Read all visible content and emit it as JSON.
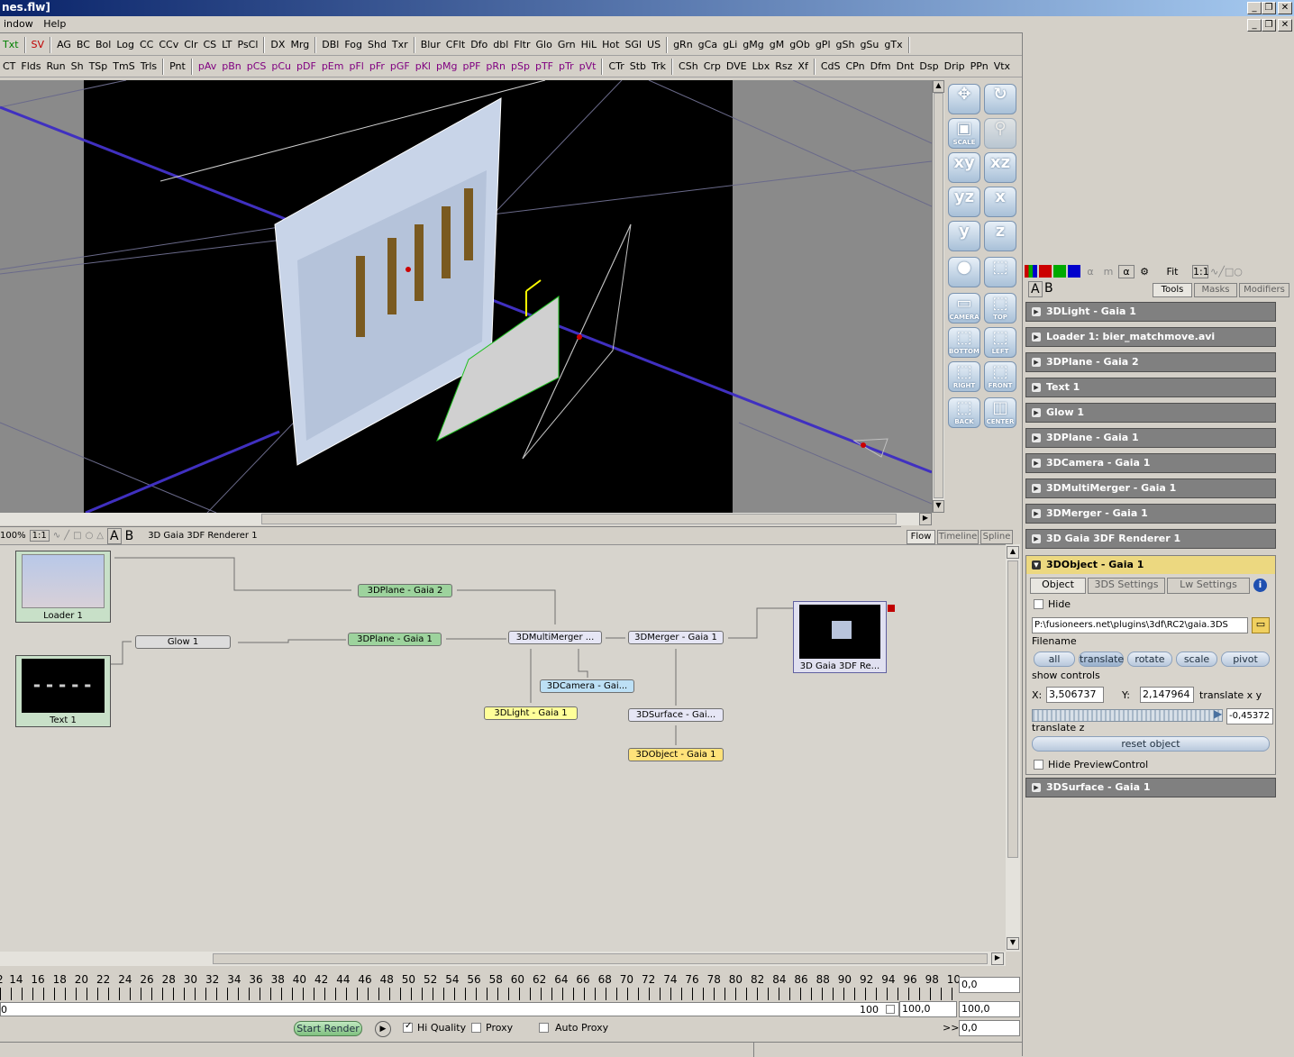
{
  "window": {
    "title": "nes.flw]"
  },
  "menu": {
    "items": [
      "indow",
      "Help"
    ]
  },
  "toolbar1": {
    "items": [
      {
        "t": "Txt",
        "c": "green"
      },
      {
        "t": "|"
      },
      {
        "t": "SV",
        "c": "red"
      },
      {
        "t": "|"
      },
      {
        "t": "AG"
      },
      {
        "t": "BC"
      },
      {
        "t": "Bol"
      },
      {
        "t": "Log"
      },
      {
        "t": "CC"
      },
      {
        "t": "CCv"
      },
      {
        "t": "Clr"
      },
      {
        "t": "CS"
      },
      {
        "t": "LT"
      },
      {
        "t": "PsCl"
      },
      {
        "t": "|"
      },
      {
        "t": "DX"
      },
      {
        "t": "Mrg"
      },
      {
        "t": "|"
      },
      {
        "t": "DBl"
      },
      {
        "t": "Fog"
      },
      {
        "t": "Shd"
      },
      {
        "t": "Txr"
      },
      {
        "t": "|"
      },
      {
        "t": "Blur"
      },
      {
        "t": "CFlt"
      },
      {
        "t": "Dfo"
      },
      {
        "t": "dbl"
      },
      {
        "t": "Fltr"
      },
      {
        "t": "Glo"
      },
      {
        "t": "Grn"
      },
      {
        "t": "HiL"
      },
      {
        "t": "Hot"
      },
      {
        "t": "SGl"
      },
      {
        "t": "US"
      },
      {
        "t": "|"
      },
      {
        "t": "gRn"
      },
      {
        "t": "gCa"
      },
      {
        "t": "gLi"
      },
      {
        "t": "gMg"
      },
      {
        "t": "gM"
      },
      {
        "t": "gOb"
      },
      {
        "t": "gPl"
      },
      {
        "t": "gSh"
      },
      {
        "t": "gSu"
      },
      {
        "t": "gTx"
      },
      {
        "t": "|"
      }
    ]
  },
  "toolbar2": {
    "items": [
      {
        "t": "CT"
      },
      {
        "t": "Flds"
      },
      {
        "t": "Run"
      },
      {
        "t": "Sh"
      },
      {
        "t": "TSp"
      },
      {
        "t": "TmS"
      },
      {
        "t": "Trls"
      },
      {
        "t": "|"
      },
      {
        "t": "Pnt"
      },
      {
        "t": "|"
      },
      {
        "t": "pAv",
        "c": "purple"
      },
      {
        "t": "pBn",
        "c": "purple"
      },
      {
        "t": "pCS",
        "c": "purple"
      },
      {
        "t": "pCu",
        "c": "purple"
      },
      {
        "t": "pDF",
        "c": "purple"
      },
      {
        "t": "pEm",
        "c": "purple"
      },
      {
        "t": "pFl",
        "c": "purple"
      },
      {
        "t": "pFr",
        "c": "purple"
      },
      {
        "t": "pGF",
        "c": "purple"
      },
      {
        "t": "pKl",
        "c": "purple"
      },
      {
        "t": "pMg",
        "c": "purple"
      },
      {
        "t": "pPF",
        "c": "purple"
      },
      {
        "t": "pRn",
        "c": "purple"
      },
      {
        "t": "pSp",
        "c": "purple"
      },
      {
        "t": "pTF",
        "c": "purple"
      },
      {
        "t": "pTr",
        "c": "purple"
      },
      {
        "t": "pVt",
        "c": "purple"
      },
      {
        "t": "|"
      },
      {
        "t": "CTr"
      },
      {
        "t": "Stb"
      },
      {
        "t": "Trk"
      },
      {
        "t": "|"
      },
      {
        "t": "CSh"
      },
      {
        "t": "Crp"
      },
      {
        "t": "DVE"
      },
      {
        "t": "Lbx"
      },
      {
        "t": "Rsz"
      },
      {
        "t": "Xf"
      },
      {
        "t": "|"
      },
      {
        "t": "CdS"
      },
      {
        "t": "CPn"
      },
      {
        "t": "Dfm"
      },
      {
        "t": "Dnt"
      },
      {
        "t": "Dsp"
      },
      {
        "t": "Drip"
      },
      {
        "t": "PPn"
      },
      {
        "t": "Vtx"
      }
    ]
  },
  "tools3d": {
    "labels": [
      "SCALE",
      "CAMERA",
      "TOP",
      "BOTTOM",
      "LEFT",
      "RIGHT",
      "FRONT",
      "BACK",
      "CENTER"
    ],
    "axes": [
      "xy",
      "xz",
      "yz",
      "x",
      "y",
      "z"
    ]
  },
  "viewer": {
    "zoom": "100%",
    "ratio": "1:1",
    "a": "A",
    "b": "B",
    "title": "3D Gaia 3DF Renderer 1",
    "tabs": [
      "Flow",
      "Timeline",
      "Spline"
    ]
  },
  "flow": {
    "nodes": {
      "loader": "Loader 1",
      "text": "Text 1",
      "plane2": "3DPlane - Gaia 2",
      "glow": "Glow 1",
      "plane1": "3DPlane - Gaia 1",
      "multimerger": "3DMultiMerger ...",
      "merger": "3DMerger - Gaia 1",
      "camera": "3DCamera - Gai...",
      "light": "3DLight - Gaia 1",
      "surface": "3DSurface - Gai...",
      "object": "3DObject - Gaia 1",
      "renderer": "3D Gaia 3DF Re..."
    }
  },
  "timeline": {
    "ticks": [
      "2",
      "14",
      "16",
      "18",
      "20",
      "22",
      "24",
      "26",
      "28",
      "30",
      "32",
      "34",
      "36",
      "38",
      "40",
      "42",
      "44",
      "46",
      "48",
      "50",
      "52",
      "54",
      "56",
      "58",
      "60",
      "62",
      "64",
      "66",
      "68",
      "70",
      "72",
      "74",
      "76",
      "78",
      "80",
      "82",
      "84",
      "86",
      "88",
      "90",
      "92",
      "94",
      "96",
      "98",
      "10"
    ],
    "field_top": "0,0",
    "start": "0",
    "end_label": "100",
    "end_value": "100,0",
    "field_mid": "100,0",
    "field_bottom": "0,0",
    "render_label": "Start Render",
    "hiquality": "Hi Quality",
    "proxy": "Proxy",
    "autoproxy": "Auto Proxy",
    "ff": ">>"
  },
  "panel": {
    "fit": "Fit",
    "ratio": "1:1",
    "a": "A",
    "b": "B",
    "tabs": [
      "Tools",
      "Masks",
      "Modifiers"
    ],
    "controls": [
      "3DLight - Gaia 1",
      "Loader 1: bier_matchmove.avi",
      "3DPlane - Gaia 2",
      "Text 1",
      "Glow 1",
      "3DPlane - Gaia 1",
      "3DCamera - Gaia 1",
      "3DMultiMerger - Gaia 1",
      "3DMerger - Gaia 1",
      "3D Gaia 3DF Renderer 1"
    ],
    "active": {
      "title": "3DObject - Gaia 1",
      "subtabs": [
        "Object",
        "3DS Settings",
        "Lw Settings"
      ],
      "hide": "Hide",
      "filename": "P:\\fusioneers.net\\plugins\\3df\\RC2\\gaia.3DS",
      "filename_label": "Filename",
      "buttons": [
        "all",
        "translate",
        "rotate",
        "scale",
        "pivot"
      ],
      "show_controls": "show controls",
      "x_label": "X:",
      "x_value": "3,506737",
      "y_label": "Y:",
      "y_value": "2,147964",
      "xy_label": "translate x y",
      "z_value": "-0,45372",
      "z_label": "translate z",
      "reset": "reset object",
      "hide_preview": "Hide PreviewControl"
    },
    "last": "3DSurface - Gaia 1"
  }
}
